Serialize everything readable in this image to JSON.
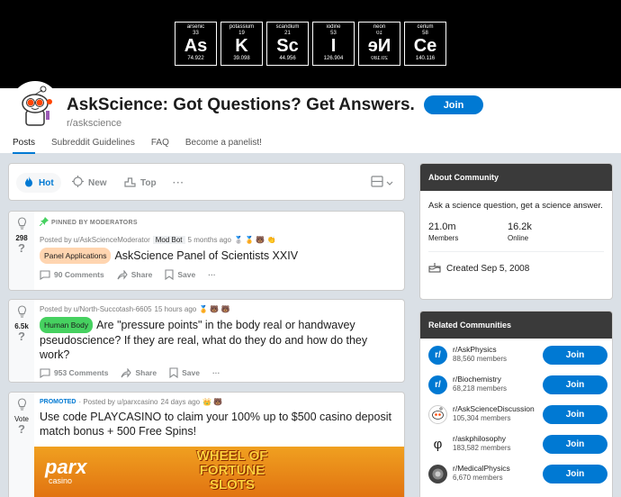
{
  "banner": {
    "elements": [
      {
        "name": "arsenic",
        "number": "33",
        "symbol": "As",
        "weight": "74.922",
        "mirrored": false
      },
      {
        "name": "potassium",
        "number": "19",
        "symbol": "K",
        "weight": "39.098",
        "mirrored": false
      },
      {
        "name": "scandium",
        "number": "21",
        "symbol": "Sc",
        "weight": "44.956",
        "mirrored": false
      },
      {
        "name": "iodine",
        "number": "53",
        "symbol": "I",
        "weight": "126.904",
        "mirrored": false
      },
      {
        "name": "neon",
        "number": "10",
        "symbol": "Ne",
        "weight": "20.180",
        "mirrored": true
      },
      {
        "name": "cerium",
        "number": "58",
        "symbol": "Ce",
        "weight": "140.116",
        "mirrored": false
      }
    ]
  },
  "header": {
    "title": "AskScience: Got Questions? Get Answers.",
    "subreddit": "r/askscience",
    "join_label": "Join",
    "tabs": [
      "Posts",
      "Subreddit Guidelines",
      "FAQ",
      "Become a panelist!"
    ]
  },
  "sortbar": {
    "hot": "Hot",
    "new": "New",
    "top": "Top",
    "more": "···"
  },
  "posts": [
    {
      "votes": "298",
      "pinned_label": "PINNED BY MODERATORS",
      "posted_by": "Posted by u/AskScienceModerator",
      "badge": "Mod Bot",
      "time": "5 months ago",
      "awards": "2 3 4 4",
      "flair": "Panel Applications",
      "flair_color": "#ffd5b0",
      "title": "AskScience Panel of Scientists XXIV",
      "comments": "90 Comments",
      "share": "Share",
      "save": "Save",
      "more": "···"
    },
    {
      "votes": "6.5k",
      "posted_by": "Posted by u/North-Succotash-6605",
      "time": "15 hours ago",
      "awards": "4 3",
      "flair": "Human Body",
      "flair_color": "#46d160",
      "title": "Are \"pressure points\" in the body real or handwavey pseudoscience? If they are real, what do they do and how do they work?",
      "comments": "953 Comments",
      "share": "Share",
      "save": "Save",
      "more": "···"
    },
    {
      "votes": "Vote",
      "promoted_label": "PROMOTED",
      "posted_by": "· Posted by u/parxcasino",
      "time": "24 days ago",
      "title": "Use code PLAYCASINO to claim your 100% up to $500 casino deposit match bonus + 500 Free Spins!",
      "ad_brand": "parx",
      "ad_brand_sub": "casino",
      "ad_headline": "WHEEL OF FORTUNE SLOTS"
    }
  ],
  "about": {
    "heading": "About Community",
    "description": "Ask a science question, get a science answer.",
    "members_value": "21.0m",
    "members_label": "Members",
    "online_value": "16.2k",
    "online_label": "Online",
    "created": "Created Sep 5, 2008"
  },
  "related": {
    "heading": "Related Communities",
    "join_label": "Join",
    "items": [
      {
        "name": "r/AskPhysics",
        "members": "88,560 members",
        "icon": "r/"
      },
      {
        "name": "r/Biochemistry",
        "members": "68,218 members",
        "icon": "r/"
      },
      {
        "name": "r/AskScienceDiscussion",
        "members": "105,304 members",
        "icon": ""
      },
      {
        "name": "r/askphilosophy",
        "members": "183,582 members",
        "icon": "φ"
      },
      {
        "name": "r/MedicalPhysics",
        "members": "6,670 members",
        "icon": ""
      }
    ]
  },
  "colors": {
    "accent": "#0079d3",
    "banner": "#000000",
    "sidebar_header": "#3a3a3a",
    "pin": "#46d160"
  }
}
